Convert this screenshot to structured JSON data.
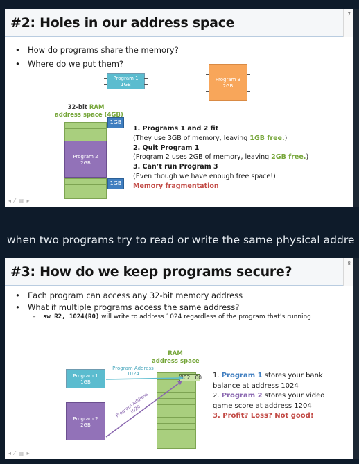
{
  "slide1": {
    "title": "#2: Holes in our address space",
    "slide_number": "7",
    "bullets": [
      "How do programs share the memory?",
      "Where do we put them?"
    ],
    "prog1": {
      "name": "Program 1",
      "size": "1GB"
    },
    "prog3": {
      "name": "Program 3",
      "size": "2GB"
    },
    "ram_label_line1_prefix": "32-bit ",
    "ram_label_line1_accent": "RAM",
    "ram_label_line2": "address space (4GB)",
    "prog2": {
      "name": "Program 2",
      "size": "2GB"
    },
    "callout_top": "1GB",
    "callout_bottom": "1GB",
    "steps": {
      "s1_title": "1. Programs 1 and 2 fit",
      "s1_pre": "(They use 3GB of memory, leaving ",
      "s1_accent": "1GB free.",
      "s1_post": ")",
      "s2_title": "2. Quit Program 1",
      "s2_pre": "(Program 2 uses 2GB of memory, leaving ",
      "s2_accent": "2GB free.",
      "s2_post": ")",
      "s3_title": "3. Can’t run Program 3",
      "s3_note": "(Even though we have enough free space!)",
      "s3_red": "Memory fragmentation"
    }
  },
  "between_text": "when two programs try to read or write the same physical addre",
  "slide2": {
    "title": "#3: How do we keep programs secure?",
    "slide_number": "8",
    "bullets": [
      "Each program can access any 32-bit memory address",
      "What if multiple programs access the same address?"
    ],
    "sub_code": "sw R2, 1024(R0)",
    "sub_rest": " will write to address 1024 regardless of the program that’s running",
    "ram_label_line1": "RAM",
    "ram_label_line2": "address space",
    "prog1": {
      "name": "Program 1",
      "size": "1GB"
    },
    "prog2": {
      "name": "Program 2",
      "size": "2GB"
    },
    "arrow1_label_line1": "Program Address",
    "arrow1_label_line2": "1024",
    "arrow2_label_line1": "Program Address",
    "arrow2_label_line2": "1024",
    "cell_value": "802   00",
    "steps": {
      "s1_pre": "1. ",
      "s1_accent": "Program 1",
      "s1_post": " stores your bank",
      "s1_line2": "balance at address 1024",
      "s2_pre": "2. ",
      "s2_accent": "Program 2",
      "s2_post": " stores your video",
      "s2_line2": "game score at address 1204",
      "s3_red": "3. Profit? Loss? Not good!"
    }
  },
  "nav_controls": "◂ ⁄ ▤ ▸",
  "colors": {
    "background": "#0e1b2a",
    "ram_green": "#a9cf7e",
    "program_blue": "#5bbccf",
    "program_orange": "#f8a65a",
    "program_purple": "#9272b8",
    "callout_blue": "#3f7ec0",
    "accent_green": "#76a63a",
    "accent_red": "#c24a45"
  }
}
